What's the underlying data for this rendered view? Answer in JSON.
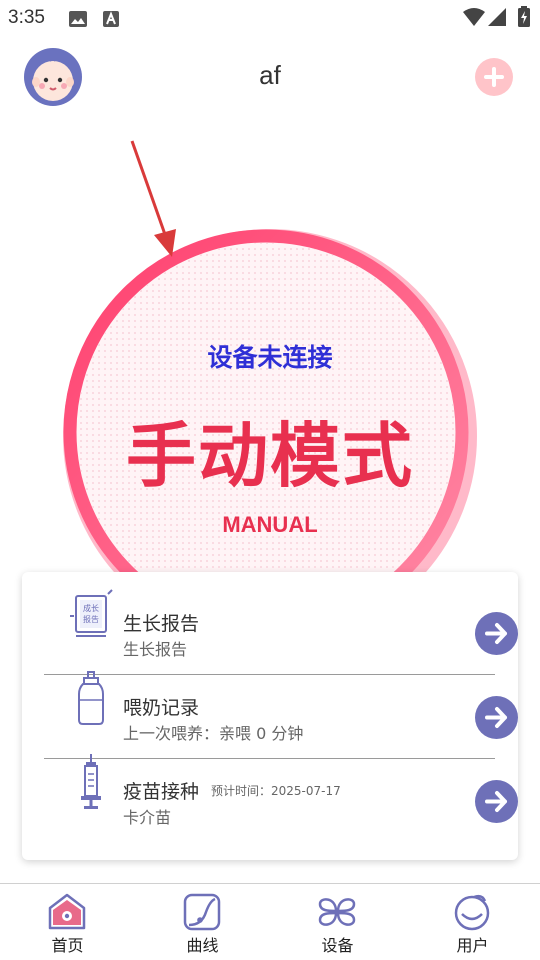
{
  "status_bar": {
    "time": "3:35"
  },
  "header": {
    "title": "af",
    "avatar_icon": "baby-face-icon",
    "add_icon": "plus-icon"
  },
  "mode_panel": {
    "status": "设备未连接",
    "mode": "手动模式",
    "mode_en": "MANUAL"
  },
  "card": {
    "rows": [
      {
        "icon": "growth-report-icon",
        "icon_text": [
          "成长",
          "报告"
        ],
        "title": "生长报告",
        "subtitle": "生长报告",
        "note": ""
      },
      {
        "icon": "baby-bottle-icon",
        "title": "喂奶记录",
        "subtitle": "上一次喂养：亲喂 0 分钟",
        "note": ""
      },
      {
        "icon": "syringe-icon",
        "title": "疫苗接种",
        "subtitle": "卡介苗",
        "note": "预计时间：2025-07-17"
      }
    ]
  },
  "bottom_nav": {
    "items": [
      {
        "label": "首页",
        "icon": "home-icon"
      },
      {
        "label": "曲线",
        "icon": "curve-icon"
      },
      {
        "label": "设备",
        "icon": "device-icon"
      },
      {
        "label": "用户",
        "icon": "user-icon"
      }
    ]
  },
  "colors": {
    "accent": "#e8304f",
    "ring": "#ff5f86",
    "primary": "#6e70b8",
    "status_text": "#2f2fd6"
  }
}
